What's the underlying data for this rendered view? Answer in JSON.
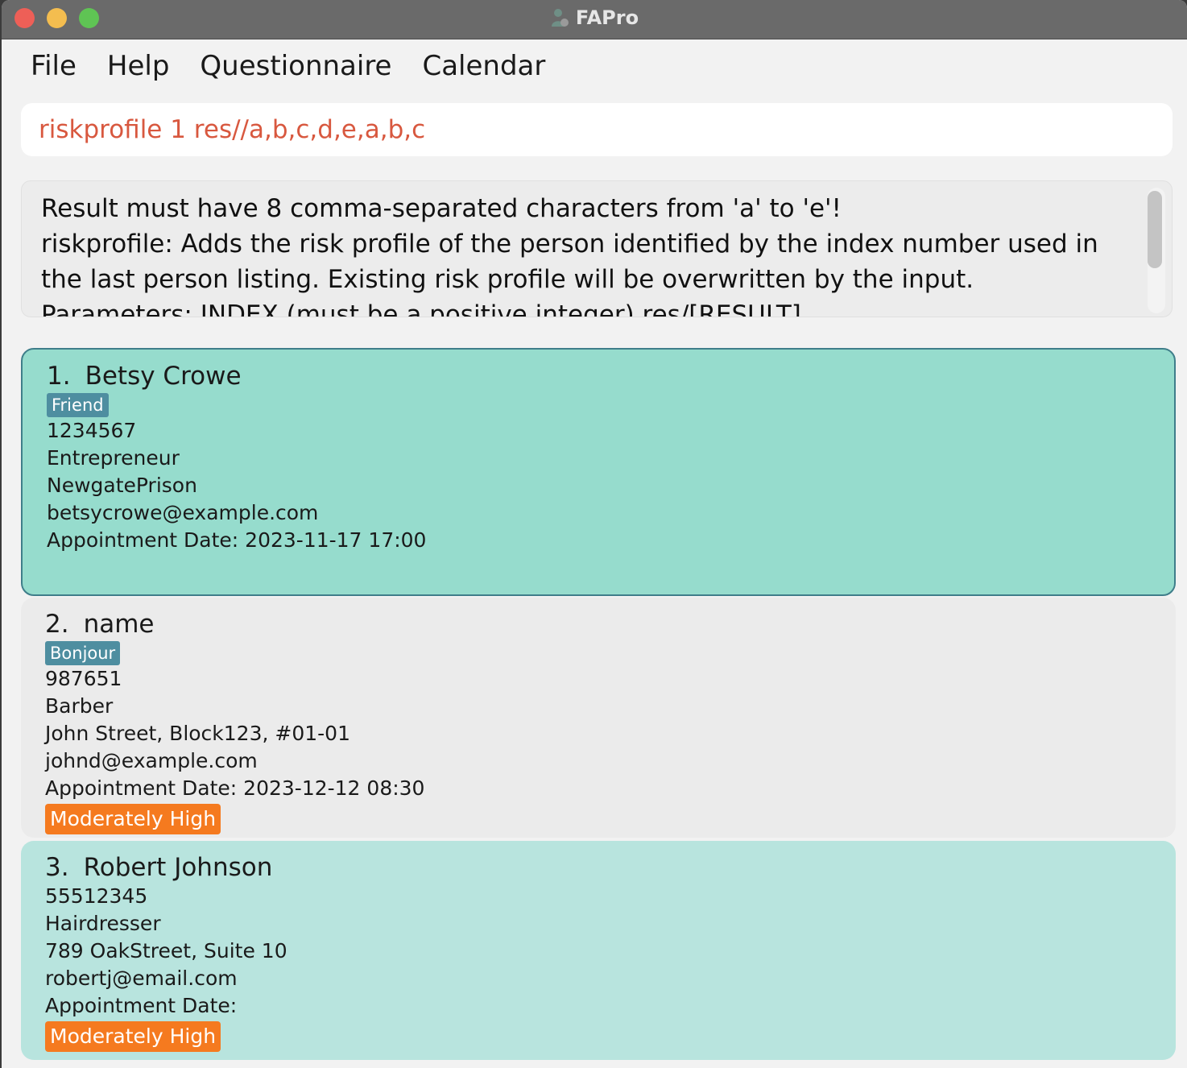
{
  "window": {
    "title": "FAPro",
    "app_icon": "advisor-person-icon"
  },
  "menu": [
    "File",
    "Help",
    "Questionnaire",
    "Calendar"
  ],
  "command": {
    "value": "riskprofile 1 res//a,b,c,d,e,a,b,c",
    "text_color": "#d8583f"
  },
  "result": {
    "lines": [
      "Result must have 8 comma-separated characters from 'a' to 'e'!",
      "riskprofile: Adds the risk profile of the person identified by the index number used in the last person listing. Existing risk profile will be overwritten by the input.",
      "Parameters: INDEX (must be a positive integer) res/[RESULT]"
    ]
  },
  "persons": [
    {
      "index": "1.",
      "name": "Betsy Crowe",
      "tag": "Friend",
      "phone": "1234567",
      "occupation": "Entrepreneur",
      "address": "NewgatePrison",
      "email": "betsycrowe@example.com",
      "appointment": "Appointment Date: 2023-11-17 17:00",
      "risk": "",
      "selected": true
    },
    {
      "index": "2.",
      "name": "name",
      "tag": "Bonjour",
      "phone": "987651",
      "occupation": "Barber",
      "address": "John Street, Block123, #01-01",
      "email": "johnd@example.com",
      "appointment": "Appointment Date: 2023-12-12 08:30",
      "risk": "Moderately High",
      "selected": false
    },
    {
      "index": "3.",
      "name": "Robert Johnson",
      "tag": "",
      "phone": "55512345",
      "occupation": "Hairdresser",
      "address": "789 OakStreet, Suite 10",
      "email": "robertj@email.com",
      "appointment": "Appointment Date:",
      "risk": "Moderately High",
      "selected": false
    }
  ],
  "colors": {
    "selected_card": "#96dccd",
    "card_alt": "#ebebeb",
    "card_teal": "#b8e4de",
    "tag": "#4e8ea0",
    "risk_badge": "#f57a1f"
  }
}
